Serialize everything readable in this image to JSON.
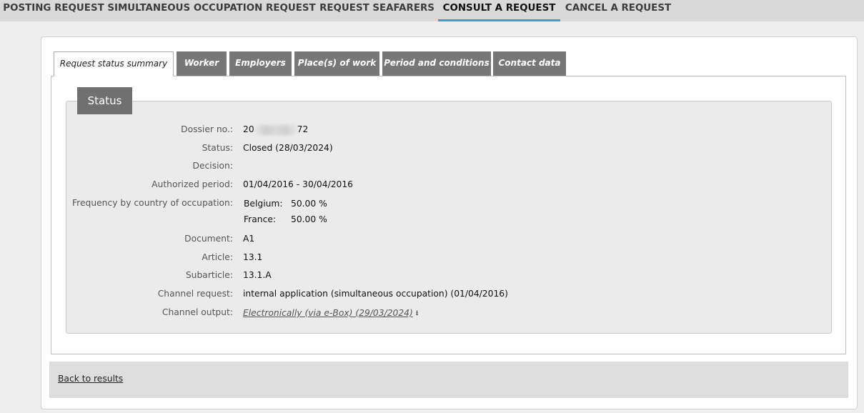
{
  "topnav": {
    "tabs": [
      {
        "label": "POSTING REQUEST"
      },
      {
        "label": "SIMULTANEOUS OCCUPATION REQUEST"
      },
      {
        "label": "REQUEST SEAFARERS"
      },
      {
        "label": "CONSULT A REQUEST"
      },
      {
        "label": "CANCEL A REQUEST"
      }
    ],
    "active_tab": "CONSULT A REQUEST",
    "accent_color": "#3a9fd5"
  },
  "content_tabs": [
    {
      "label": "Request status summary"
    },
    {
      "label": "Worker"
    },
    {
      "label": "Employers"
    },
    {
      "label": "Place(s) of work"
    },
    {
      "label": "Period and conditions"
    },
    {
      "label": "Contact data"
    }
  ],
  "status": {
    "heading": "Status",
    "fields": {
      "dossier_label": "Dossier no.:",
      "dossier_prefix": "20",
      "dossier_suffix": "72",
      "status_label": "Status:",
      "status_value": "Closed (28/03/2024)",
      "decision_label": "Decision:",
      "decision_value": "",
      "period_label": "Authorized period:",
      "period_value": "01/04/2016 - 30/04/2016",
      "frequency_label": "Frequency by country of occupation:",
      "frequency": [
        {
          "country": "Belgium:",
          "value": "50.00 %"
        },
        {
          "country": "France:",
          "value": "50.00 %"
        }
      ],
      "document_label": "Document:",
      "document_value": "A1",
      "article_label": "Article:",
      "article_value": "13.1",
      "subarticle_label": "Subarticle:",
      "subarticle_value": "13.1.A",
      "channel_request_label": "Channel request:",
      "channel_request_value": "internal application (simultaneous occupation) (01/04/2016)",
      "channel_output_label": "Channel output:",
      "channel_output_value": "Electronically (via e-Box) (29/03/2024)",
      "channel_output_icon": "download-icon"
    }
  },
  "footer": {
    "back_label": "Back to results"
  }
}
